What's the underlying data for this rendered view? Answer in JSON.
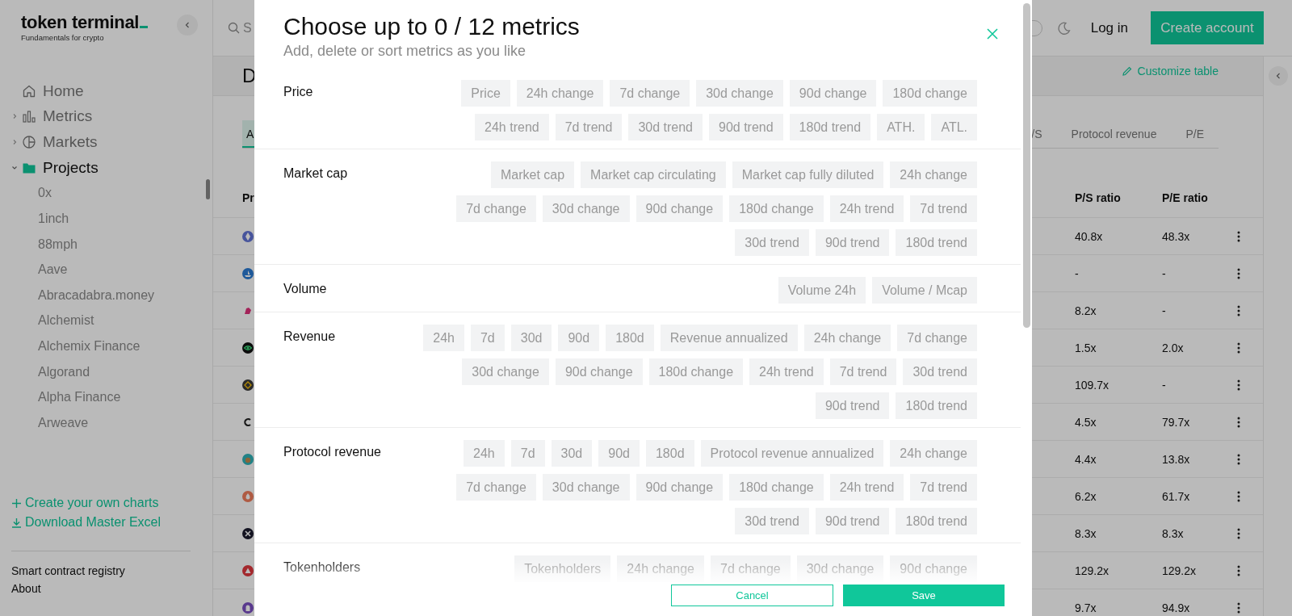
{
  "sidebar": {
    "logo": "token terminal",
    "tagline": "Fundamentals for crypto",
    "nav": [
      {
        "label": "Home",
        "kind": "link",
        "selected": false
      },
      {
        "label": "Metrics",
        "kind": "group",
        "expanded": false,
        "selected": false
      },
      {
        "label": "Markets",
        "kind": "group",
        "expanded": false,
        "selected": false
      },
      {
        "label": "Projects",
        "kind": "group",
        "expanded": true,
        "selected": true,
        "children": [
          {
            "label": "0x"
          },
          {
            "label": "1inch"
          },
          {
            "label": "88mph"
          },
          {
            "label": "Aave"
          },
          {
            "label": "Abracadabra.money"
          },
          {
            "label": "Alchemist"
          },
          {
            "label": "Alchemix Finance"
          },
          {
            "label": "Algorand"
          },
          {
            "label": "Alpha Finance"
          },
          {
            "label": "Arweave"
          }
        ]
      }
    ],
    "actions": [
      {
        "label": "Create your own charts",
        "kind": "create"
      },
      {
        "label": "Download Master Excel",
        "kind": "download"
      }
    ],
    "footer_links": [
      "Smart contract registry",
      "About"
    ]
  },
  "topbar": {
    "search": {
      "placeholder": "S"
    },
    "dark_mode": false,
    "login": "Log in",
    "create_account": "Create account"
  },
  "page": {
    "title": "D",
    "customize": "Customize table",
    "tabs_left": [
      {
        "label": "A",
        "selected": true
      }
    ],
    "tabs_right": [
      {
        "label": "/S",
        "selected": false
      },
      {
        "label": "Protocol revenue",
        "selected": false
      },
      {
        "label": "P/E",
        "selected": false
      }
    ]
  },
  "table": {
    "columns": [
      "Pr",
      "P/S ratio",
      "P/E ratio"
    ],
    "rows": [
      {
        "ps": "40.8x",
        "pe": "48.3x"
      },
      {
        "ps": "-",
        "pe": "-"
      },
      {
        "ps": "8.2x",
        "pe": "-"
      },
      {
        "ps": "1.5x",
        "pe": "2.0x"
      },
      {
        "ps": "109.7x",
        "pe": "-"
      },
      {
        "ps": "4.5x",
        "pe": "79.7x"
      },
      {
        "ps": "4.4x",
        "pe": "13.8x"
      },
      {
        "ps": "6.2x",
        "pe": "61.7x"
      },
      {
        "ps": "8.3x",
        "pe": "8.3x"
      },
      {
        "ps": "129.2x",
        "pe": "129.2x"
      },
      {
        "ps": "9.7x",
        "pe": "94.9x"
      }
    ]
  },
  "modal": {
    "title": "Choose up to 0 / 12 metrics",
    "subtitle": "Add, delete or sort metrics as you like",
    "sections": [
      {
        "label": "Price",
        "metrics": [
          {
            "label": "Price",
            "selected": false
          },
          {
            "label": "24h change",
            "selected": false
          },
          {
            "label": "7d change",
            "selected": false
          },
          {
            "label": "30d change",
            "selected": false
          },
          {
            "label": "90d change",
            "selected": false
          },
          {
            "label": "180d change",
            "selected": false
          },
          {
            "label": "24h trend",
            "selected": false
          },
          {
            "label": "7d trend",
            "selected": false
          },
          {
            "label": "30d trend",
            "selected": false
          },
          {
            "label": "90d trend",
            "selected": false
          },
          {
            "label": "180d trend",
            "selected": false
          },
          {
            "label": "ATH.",
            "selected": false
          },
          {
            "label": "ATL.",
            "selected": false
          }
        ]
      },
      {
        "label": "Market cap",
        "metrics": [
          {
            "label": "Market cap",
            "selected": false
          },
          {
            "label": "Market cap circulating",
            "selected": false
          },
          {
            "label": "Market cap fully diluted",
            "selected": false
          },
          {
            "label": "24h change",
            "selected": false
          },
          {
            "label": "7d change",
            "selected": false
          },
          {
            "label": "30d change",
            "selected": false
          },
          {
            "label": "90d change",
            "selected": false
          },
          {
            "label": "180d change",
            "selected": false
          },
          {
            "label": "24h trend",
            "selected": false
          },
          {
            "label": "7d trend",
            "selected": false
          },
          {
            "label": "30d trend",
            "selected": false
          },
          {
            "label": "90d trend",
            "selected": false
          },
          {
            "label": "180d trend",
            "selected": false
          }
        ]
      },
      {
        "label": "Volume",
        "metrics": [
          {
            "label": "Volume 24h",
            "selected": false
          },
          {
            "label": "Volume / Mcap",
            "selected": false
          }
        ]
      },
      {
        "label": "Revenue",
        "metrics": [
          {
            "label": "24h",
            "selected": false
          },
          {
            "label": "7d",
            "selected": false
          },
          {
            "label": "30d",
            "selected": false
          },
          {
            "label": "90d",
            "selected": false
          },
          {
            "label": "180d",
            "selected": false
          },
          {
            "label": "Revenue annualized",
            "selected": false
          },
          {
            "label": "24h change",
            "selected": false
          },
          {
            "label": "7d change",
            "selected": false
          },
          {
            "label": "30d change",
            "selected": false
          },
          {
            "label": "90d change",
            "selected": false
          },
          {
            "label": "180d change",
            "selected": false
          },
          {
            "label": "24h trend",
            "selected": false
          },
          {
            "label": "7d trend",
            "selected": false
          },
          {
            "label": "30d trend",
            "selected": false
          },
          {
            "label": "90d trend",
            "selected": false
          },
          {
            "label": "180d trend",
            "selected": false
          }
        ]
      },
      {
        "label": "Protocol revenue",
        "metrics": [
          {
            "label": "24h",
            "selected": false
          },
          {
            "label": "7d",
            "selected": false
          },
          {
            "label": "30d",
            "selected": false
          },
          {
            "label": "90d",
            "selected": false
          },
          {
            "label": "180d",
            "selected": false
          },
          {
            "label": "Protocol revenue annualized",
            "selected": false
          },
          {
            "label": "24h change",
            "selected": false
          },
          {
            "label": "7d change",
            "selected": false
          },
          {
            "label": "30d change",
            "selected": false
          },
          {
            "label": "90d change",
            "selected": false
          },
          {
            "label": "180d change",
            "selected": false
          },
          {
            "label": "24h trend",
            "selected": false
          },
          {
            "label": "7d trend",
            "selected": false
          },
          {
            "label": "30d trend",
            "selected": false
          },
          {
            "label": "90d trend",
            "selected": false
          },
          {
            "label": "180d trend",
            "selected": false
          }
        ]
      },
      {
        "label": "Tokenholders",
        "metrics": [
          {
            "label": "Tokenholders",
            "selected": false
          },
          {
            "label": "24h change",
            "selected": false
          },
          {
            "label": "7d change",
            "selected": false
          },
          {
            "label": "30d change",
            "selected": false
          },
          {
            "label": "90d change",
            "selected": false
          }
        ]
      }
    ],
    "buttons": {
      "cancel": "Cancel",
      "save": "Save"
    }
  }
}
